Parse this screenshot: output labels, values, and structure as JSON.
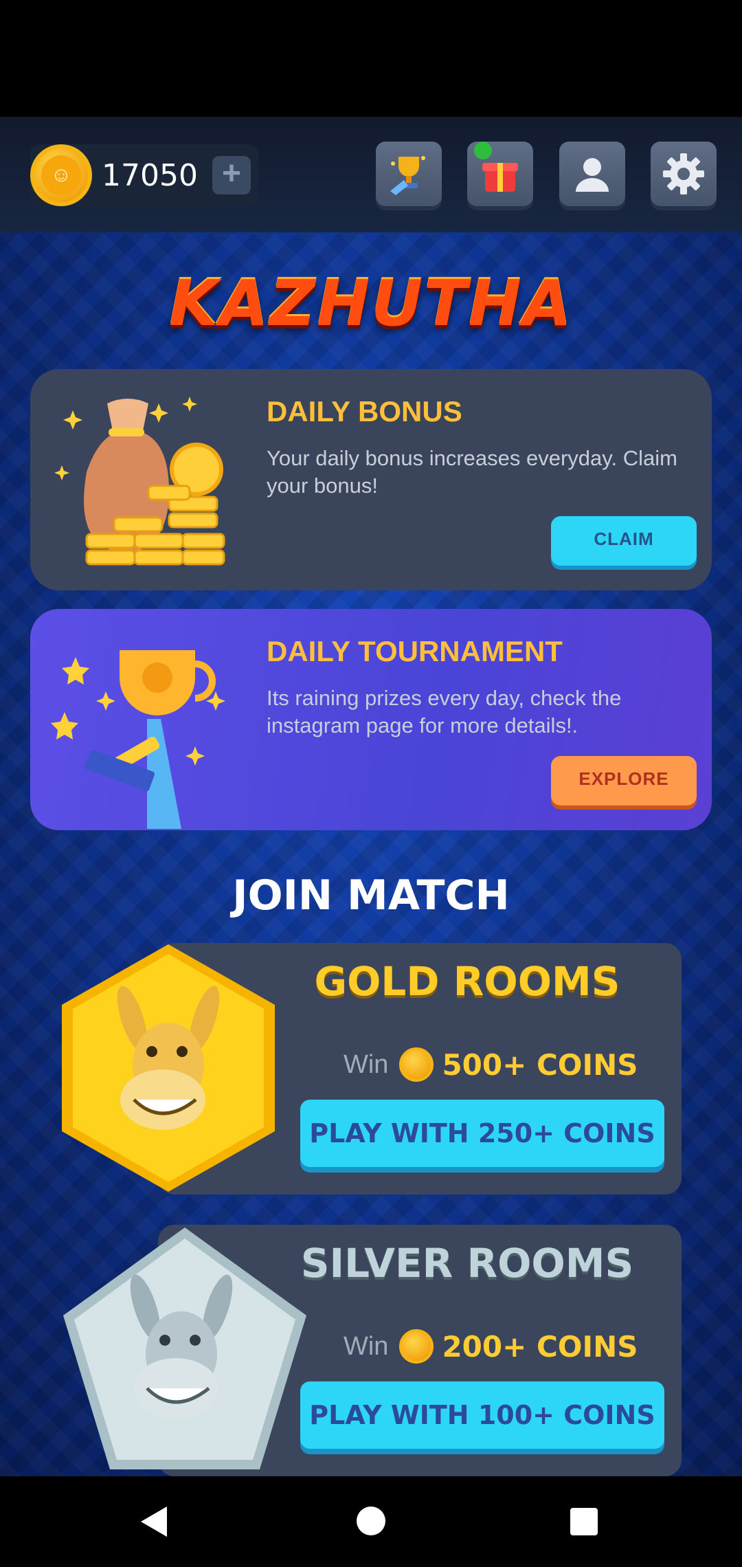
{
  "header": {
    "coins": "17050",
    "add_label": "+",
    "icons": [
      "trophy-icon",
      "gift-icon",
      "profile-icon",
      "settings-icon"
    ]
  },
  "title": "KAZHUTHA",
  "daily_bonus": {
    "title": "DAILY BONUS",
    "description": "Your daily bonus increases everyday. Claim your bonus!",
    "button": "CLAIM"
  },
  "daily_tournament": {
    "title": "DAILY TOURNAMENT",
    "description": "Its raining prizes every day, check the instagram page for more details!.",
    "button": "EXPLORE"
  },
  "join_match": {
    "title": "JOIN MATCH",
    "rooms": [
      {
        "name": "GOLD ROOMS",
        "win_label": "Win",
        "win_value": "500+ COINS",
        "button": "PLAY WITH 250+ COINS"
      },
      {
        "name": "SILVER ROOMS",
        "win_label": "Win",
        "win_value": "200+ COINS",
        "button": "PLAY WITH 100+ COINS"
      }
    ]
  },
  "colors": {
    "accent": "#2dd6f7",
    "gold": "#ffcc28",
    "orange": "#ff9a4d",
    "background": "#0d2f86"
  }
}
